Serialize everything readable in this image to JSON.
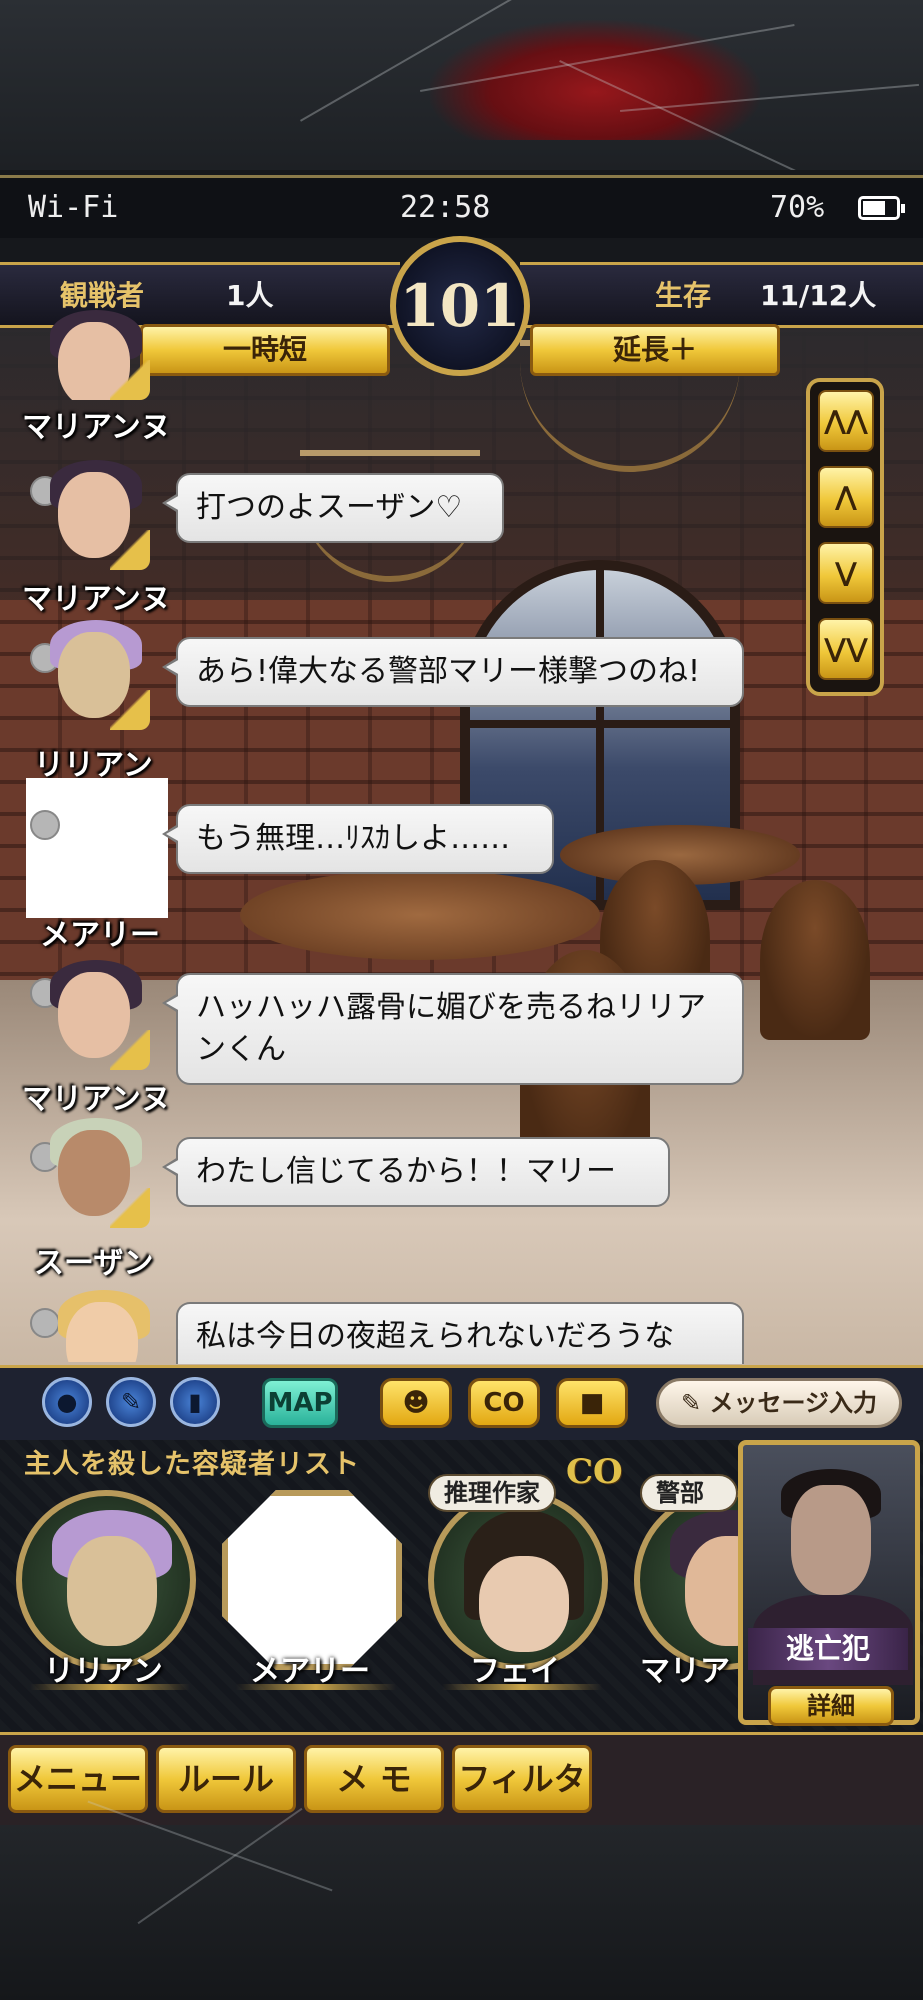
{
  "status_bar": {
    "network": "Wi-Fi",
    "time": "22:58",
    "battery_percent": "70%",
    "battery_level": 0.7
  },
  "hud": {
    "spectators_label": "観戦者",
    "spectators_value": "1人",
    "timer": "101",
    "alive_label": "生存",
    "alive_value": "11/12人",
    "shorten_label": "一時短",
    "extend_label": "延長＋"
  },
  "scroll_buttons": [
    "⋀⋀",
    "⋀",
    "⋁",
    "⋁⋁"
  ],
  "chat": [
    {
      "speaker": "マリアンヌ",
      "message": ""
    },
    {
      "speaker": "マリアンヌ",
      "message": "打つのよスーザン♡"
    },
    {
      "speaker": "リリアン",
      "message": "あら!偉大なる警部マリー様撃つのね!"
    },
    {
      "speaker": "メアリー",
      "message": "もう無理…ﾘｽｶしよ……"
    },
    {
      "speaker": "マリアンヌ",
      "message": "ハッハッハ露骨に媚びを売るねリリアンくん"
    },
    {
      "speaker": "スーザン",
      "message": "わたし信じてるから！！マリー"
    },
    {
      "speaker": "",
      "message": "私は今日の夜超えられないだろうな"
    }
  ],
  "action_bar": {
    "icons": [
      "person-icon",
      "pen-icon",
      "door-icon"
    ],
    "map_label": "MAP",
    "emote_icon": "smiley-icon",
    "co_label": "CO",
    "chat_icon": "speech-bubble-icon",
    "message_input_label": "メッセージ入力"
  },
  "suspect_list": {
    "title": "主人を殺した容疑者リスト",
    "co_badge": "CO",
    "suspects": [
      {
        "name": "リリアン",
        "role": ""
      },
      {
        "name": "メアリー",
        "role": ""
      },
      {
        "name": "フェイ",
        "role": "推理作家"
      },
      {
        "name": "マリア",
        "role": "警部"
      }
    ],
    "culprit_label": "逃亡犯",
    "detail_label": "詳細"
  },
  "bottom_menu": {
    "items": [
      "メニュー",
      "ルール",
      "メ モ",
      "フィルタ"
    ]
  },
  "colors": {
    "gold": "#c9a44a",
    "bubble": "#f1f1f1",
    "blood": "#a3161a"
  }
}
